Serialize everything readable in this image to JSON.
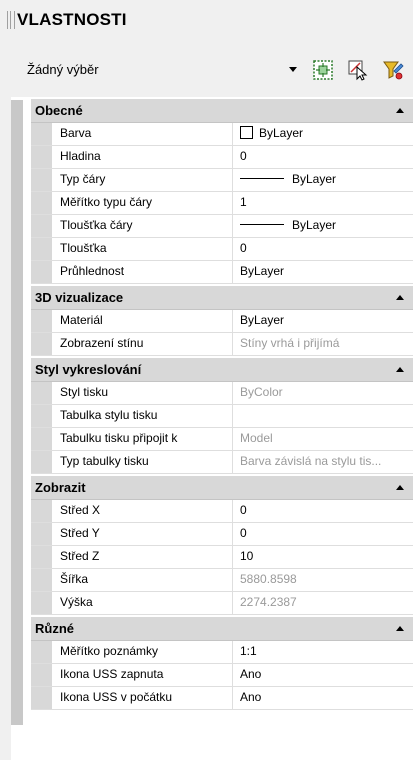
{
  "panel": {
    "title": "VLASTNOSTI"
  },
  "selection": {
    "value": "Žádný výběr"
  },
  "toolbar": {
    "quick_select_icon": "quick-select-icon",
    "select_objects_icon": "select-objects-icon",
    "toggle_pickadd_icon": "toggle-pickadd-icon"
  },
  "sections": [
    {
      "title": "Obecné",
      "rows": [
        {
          "name": "Barva",
          "value": "ByLayer",
          "swatch": true
        },
        {
          "name": "Hladina",
          "value": "0"
        },
        {
          "name": "Typ čáry",
          "value": "ByLayer",
          "line": true
        },
        {
          "name": "Měřítko typu čáry",
          "value": "1"
        },
        {
          "name": "Tloušťka čáry",
          "value": "ByLayer",
          "line": true
        },
        {
          "name": "Tloušťka",
          "value": "0"
        },
        {
          "name": "Průhlednost",
          "value": "ByLayer"
        }
      ]
    },
    {
      "title": "3D vizualizace",
      "rows": [
        {
          "name": "Materiál",
          "value": "ByLayer"
        },
        {
          "name": "Zobrazení stínu",
          "value": "Stíny vrhá i přijímá",
          "readonly": true
        }
      ]
    },
    {
      "title": "Styl vykreslování",
      "rows": [
        {
          "name": "Styl tisku",
          "value": "ByColor",
          "readonly": true
        },
        {
          "name": "Tabulka stylu tisku",
          "value": ""
        },
        {
          "name": "Tabulku tisku připojit k",
          "value": "Model",
          "readonly": true
        },
        {
          "name": "Typ tabulky tisku",
          "value": "Barva závislá na stylu tis...",
          "readonly": true
        }
      ]
    },
    {
      "title": "Zobrazit",
      "rows": [
        {
          "name": "Střed X",
          "value": "0"
        },
        {
          "name": "Střed Y",
          "value": "0"
        },
        {
          "name": "Střed Z",
          "value": "10"
        },
        {
          "name": "Šířka",
          "value": "5880.8598",
          "readonly": true
        },
        {
          "name": "Výška",
          "value": "2274.2387",
          "readonly": true
        }
      ]
    },
    {
      "title": "Různé",
      "rows": [
        {
          "name": "Měřítko poznámky",
          "value": "1:1"
        },
        {
          "name": "Ikona USS zapnuta",
          "value": "Ano"
        },
        {
          "name": "Ikona USS v počátku",
          "value": "Ano"
        }
      ]
    }
  ]
}
